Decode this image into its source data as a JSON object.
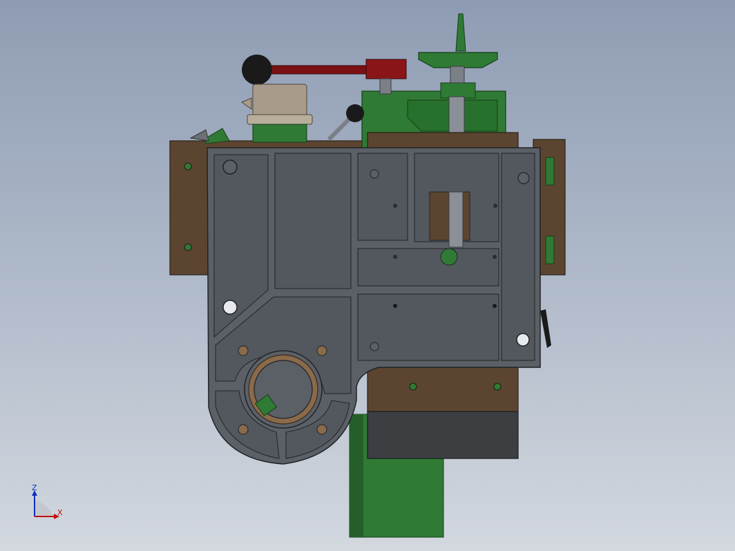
{
  "triad": {
    "z_label": "Z",
    "x_label": "X"
  },
  "colors": {
    "green_body": "#2f7a34",
    "green_dark": "#1f5a25",
    "brown_plate": "#5c4530",
    "gray_housing": "#5b5f66",
    "gray_panel": "#53575e",
    "dark_block": "#3c3e42",
    "handle_red": "#7a1014",
    "knob_black": "#1a1a1a",
    "collar_beige": "#a89b8a",
    "axis_blue": "#1030c0",
    "axis_red": "#c01010"
  }
}
